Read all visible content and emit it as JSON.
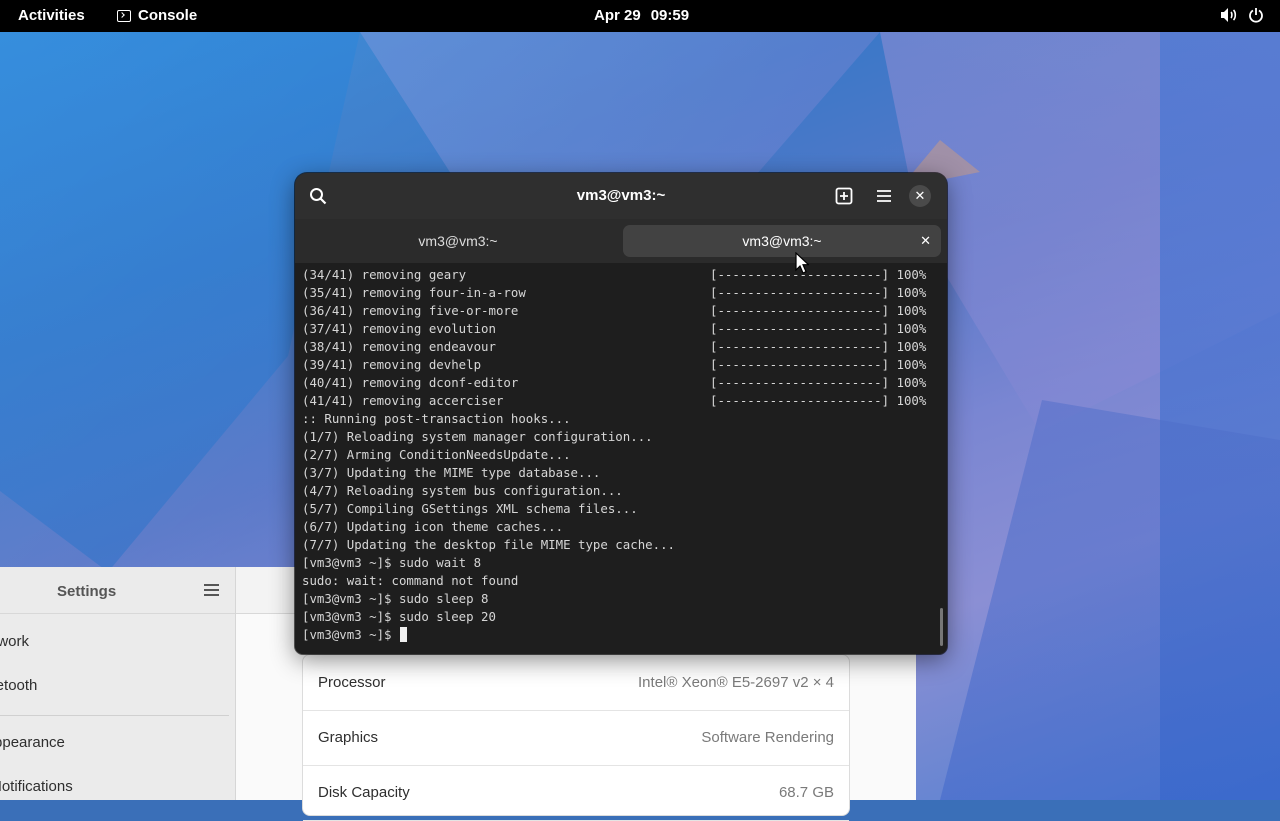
{
  "topbar": {
    "activities": "Activities",
    "app_name": "Console",
    "date": "Apr 29",
    "time": "09:59"
  },
  "terminal": {
    "title": "vm3@vm3:~",
    "tabs": [
      {
        "label": "vm3@vm3:~",
        "active": false
      },
      {
        "label": "vm3@vm3:~",
        "active": true
      }
    ],
    "lines": [
      "(34/41) removing geary",
      "(35/41) removing four-in-a-row",
      "(36/41) removing five-or-more",
      "(37/41) removing evolution",
      "(38/41) removing endeavour",
      "(39/41) removing devhelp",
      "(40/41) removing dconf-editor",
      "(41/41) removing accerciser",
      ":: Running post-transaction hooks...",
      "(1/7) Reloading system manager configuration...",
      "(2/7) Arming ConditionNeedsUpdate...",
      "(3/7) Updating the MIME type database...",
      "(4/7) Reloading system bus configuration...",
      "(5/7) Compiling GSettings XML schema files...",
      "(6/7) Updating icon theme caches...",
      "(7/7) Updating the desktop file MIME type cache...",
      "[vm3@vm3 ~]$ sudo wait 8",
      "sudo: wait: command not found",
      "[vm3@vm3 ~]$ sudo sleep 8",
      "[vm3@vm3 ~]$ sudo sleep 20"
    ],
    "progress_bar": "[----------------------]",
    "progress_value": "100%",
    "progress_rows": 8,
    "prompt": "[vm3@vm3 ~]$ "
  },
  "settings": {
    "title": "Settings",
    "sidebar_items": [
      "Network",
      "Bluetooth",
      "Appearance",
      "Notifications"
    ],
    "rows": [
      {
        "key": "Processor",
        "value": "Intel® Xeon® E5-2697 v2 × 4"
      },
      {
        "key": "Graphics",
        "value": "Software Rendering"
      },
      {
        "key": "Disk Capacity",
        "value": "68.7 GB"
      }
    ]
  },
  "colors": {
    "terminal_bg": "#1e1e1e",
    "header_bg": "#2f2f2f",
    "topbar_bg": "#000000"
  }
}
